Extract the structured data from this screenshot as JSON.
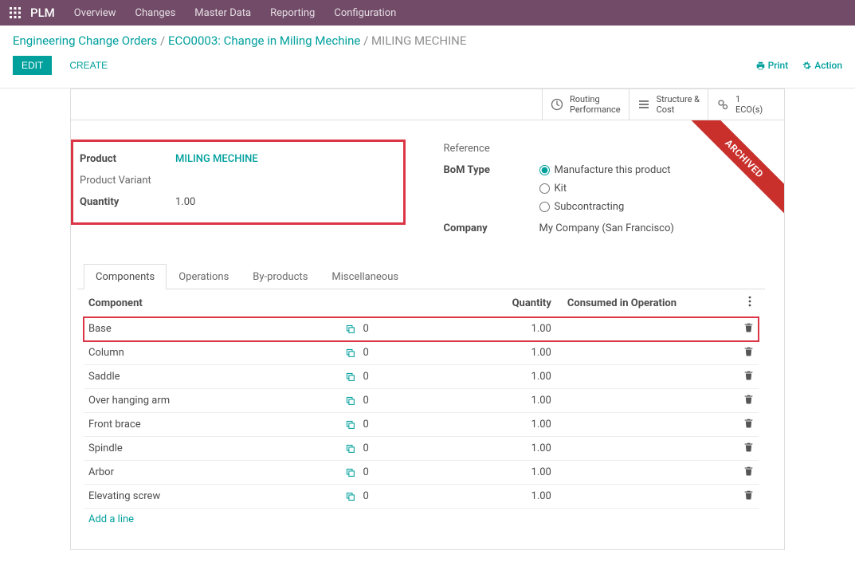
{
  "app": {
    "name": "PLM"
  },
  "nav": {
    "items": [
      {
        "label": "Overview"
      },
      {
        "label": "Changes"
      },
      {
        "label": "Master Data"
      },
      {
        "label": "Reporting"
      },
      {
        "label": "Configuration"
      }
    ]
  },
  "breadcrumb": {
    "root": "Engineering Change Orders",
    "eco": "ECO0003: Change in Miling Mechine",
    "current": "MILING MECHINE"
  },
  "buttons": {
    "edit": "EDIT",
    "create": "CREATE",
    "print": "Print",
    "action": "Action"
  },
  "stat_buttons": {
    "routing": {
      "line1": "Routing",
      "line2": "Performance"
    },
    "structure": {
      "line1": "Structure &",
      "line2": "Cost"
    },
    "ecos": {
      "count": "1",
      "label": "ECO(s)"
    }
  },
  "ribbon": "ARCHIVED",
  "fields": {
    "product": {
      "label": "Product",
      "value": "MILING MECHINE"
    },
    "variant": {
      "label": "Product Variant",
      "value": ""
    },
    "quantity": {
      "label": "Quantity",
      "value": "1.00"
    },
    "reference": {
      "label": "Reference",
      "value": ""
    },
    "bom_type": {
      "label": "BoM Type"
    },
    "company": {
      "label": "Company",
      "value": "My Company (San Francisco)"
    }
  },
  "bom_type_options": {
    "manufacture": "Manufacture this product",
    "kit": "Kit",
    "subcontracting": "Subcontracting"
  },
  "tabs": {
    "components": "Components",
    "operations": "Operations",
    "byproducts": "By-products",
    "misc": "Miscellaneous"
  },
  "components_table": {
    "headers": {
      "component": "Component",
      "quantity": "Quantity",
      "consumed": "Consumed in Operation"
    },
    "marker": "0",
    "rows": [
      {
        "name": "Base",
        "qty": "1.00"
      },
      {
        "name": "Column",
        "qty": "1.00"
      },
      {
        "name": "Saddle",
        "qty": "1.00"
      },
      {
        "name": "Over hanging arm",
        "qty": "1.00"
      },
      {
        "name": "Front brace",
        "qty": "1.00"
      },
      {
        "name": "Spindle",
        "qty": "1.00"
      },
      {
        "name": "Arbor",
        "qty": "1.00"
      },
      {
        "name": "Elevating screw",
        "qty": "1.00"
      }
    ],
    "add_line": "Add a line"
  }
}
